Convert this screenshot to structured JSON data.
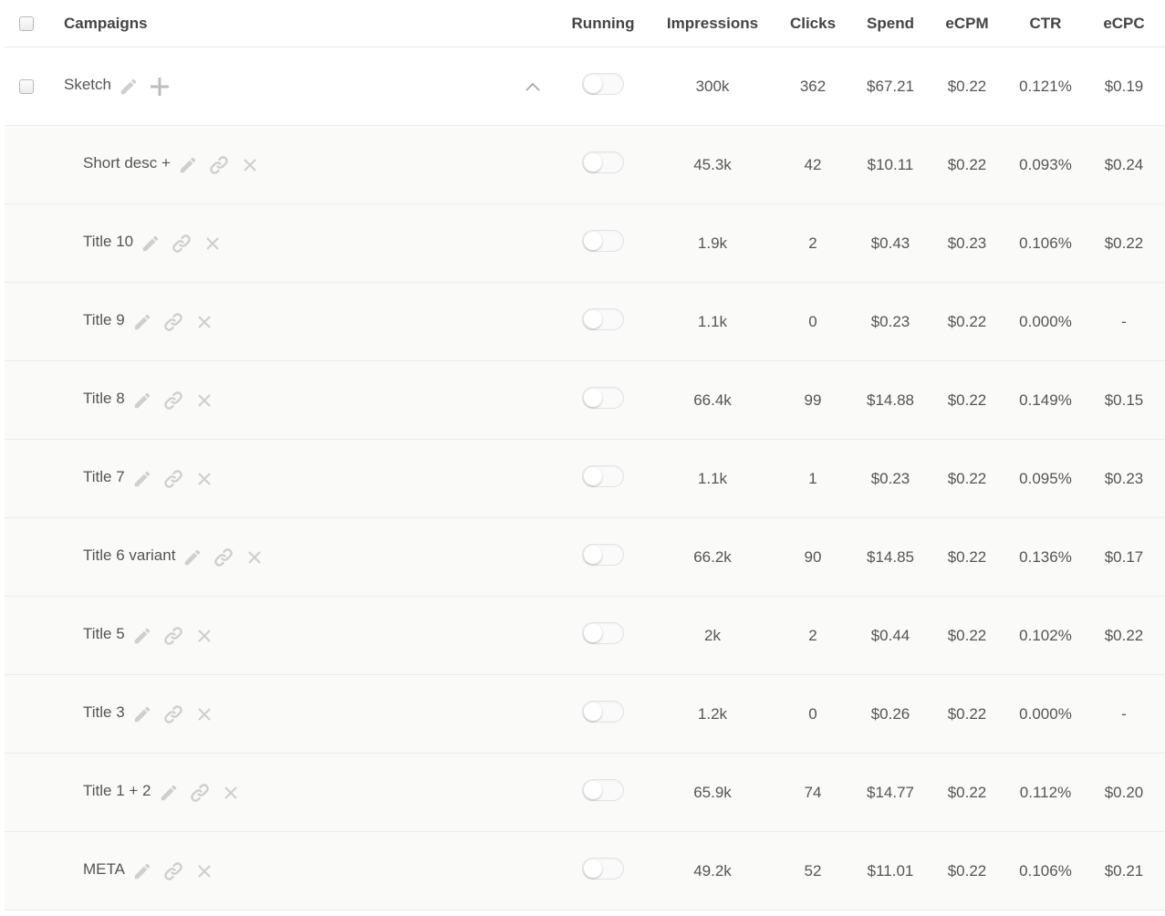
{
  "header": {
    "campaigns": "Campaigns",
    "running": "Running",
    "impressions": "Impressions",
    "clicks": "Clicks",
    "spend": "Spend",
    "ecpm": "eCPM",
    "ctr": "CTR",
    "ecpc": "eCPC"
  },
  "campaign": {
    "name": "Sketch",
    "running": false,
    "impressions": "300k",
    "clicks": "362",
    "spend": "$67.21",
    "ecpm": "$0.22",
    "ctr": "0.121%",
    "ecpc": "$0.19"
  },
  "ads": [
    {
      "name": "Short desc +",
      "running": false,
      "impressions": "45.3k",
      "clicks": "42",
      "spend": "$10.11",
      "ecpm": "$0.22",
      "ctr": "0.093%",
      "ecpc": "$0.24"
    },
    {
      "name": "Title 10",
      "running": false,
      "impressions": "1.9k",
      "clicks": "2",
      "spend": "$0.43",
      "ecpm": "$0.23",
      "ctr": "0.106%",
      "ecpc": "$0.22"
    },
    {
      "name": "Title 9",
      "running": false,
      "impressions": "1.1k",
      "clicks": "0",
      "spend": "$0.23",
      "ecpm": "$0.22",
      "ctr": "0.000%",
      "ecpc": "-"
    },
    {
      "name": "Title 8",
      "running": false,
      "impressions": "66.4k",
      "clicks": "99",
      "spend": "$14.88",
      "ecpm": "$0.22",
      "ctr": "0.149%",
      "ecpc": "$0.15"
    },
    {
      "name": "Title 7",
      "running": false,
      "impressions": "1.1k",
      "clicks": "1",
      "spend": "$0.23",
      "ecpm": "$0.22",
      "ctr": "0.095%",
      "ecpc": "$0.23"
    },
    {
      "name": "Title 6 variant",
      "running": false,
      "impressions": "66.2k",
      "clicks": "90",
      "spend": "$14.85",
      "ecpm": "$0.22",
      "ctr": "0.136%",
      "ecpc": "$0.17"
    },
    {
      "name": "Title 5",
      "running": false,
      "impressions": "2k",
      "clicks": "2",
      "spend": "$0.44",
      "ecpm": "$0.22",
      "ctr": "0.102%",
      "ecpc": "$0.22"
    },
    {
      "name": "Title 3",
      "running": false,
      "impressions": "1.2k",
      "clicks": "0",
      "spend": "$0.26",
      "ecpm": "$0.22",
      "ctr": "0.000%",
      "ecpc": "-"
    },
    {
      "name": "Title 1 + 2",
      "running": false,
      "impressions": "65.9k",
      "clicks": "74",
      "spend": "$14.77",
      "ecpm": "$0.22",
      "ctr": "0.112%",
      "ecpc": "$0.20"
    },
    {
      "name": "META",
      "running": false,
      "impressions": "49.2k",
      "clicks": "52",
      "spend": "$11.01",
      "ecpm": "$0.22",
      "ctr": "0.106%",
      "ecpc": "$0.21"
    }
  ],
  "icons": {
    "edit": "pencil-icon",
    "link": "link-icon",
    "remove": "close-icon",
    "add": "plus-icon",
    "collapse": "chevron-up-icon"
  },
  "colors": {
    "icon": "#cfcfcf",
    "row_alt": "#fafaf8",
    "border": "#ececec",
    "text": "#555555"
  }
}
